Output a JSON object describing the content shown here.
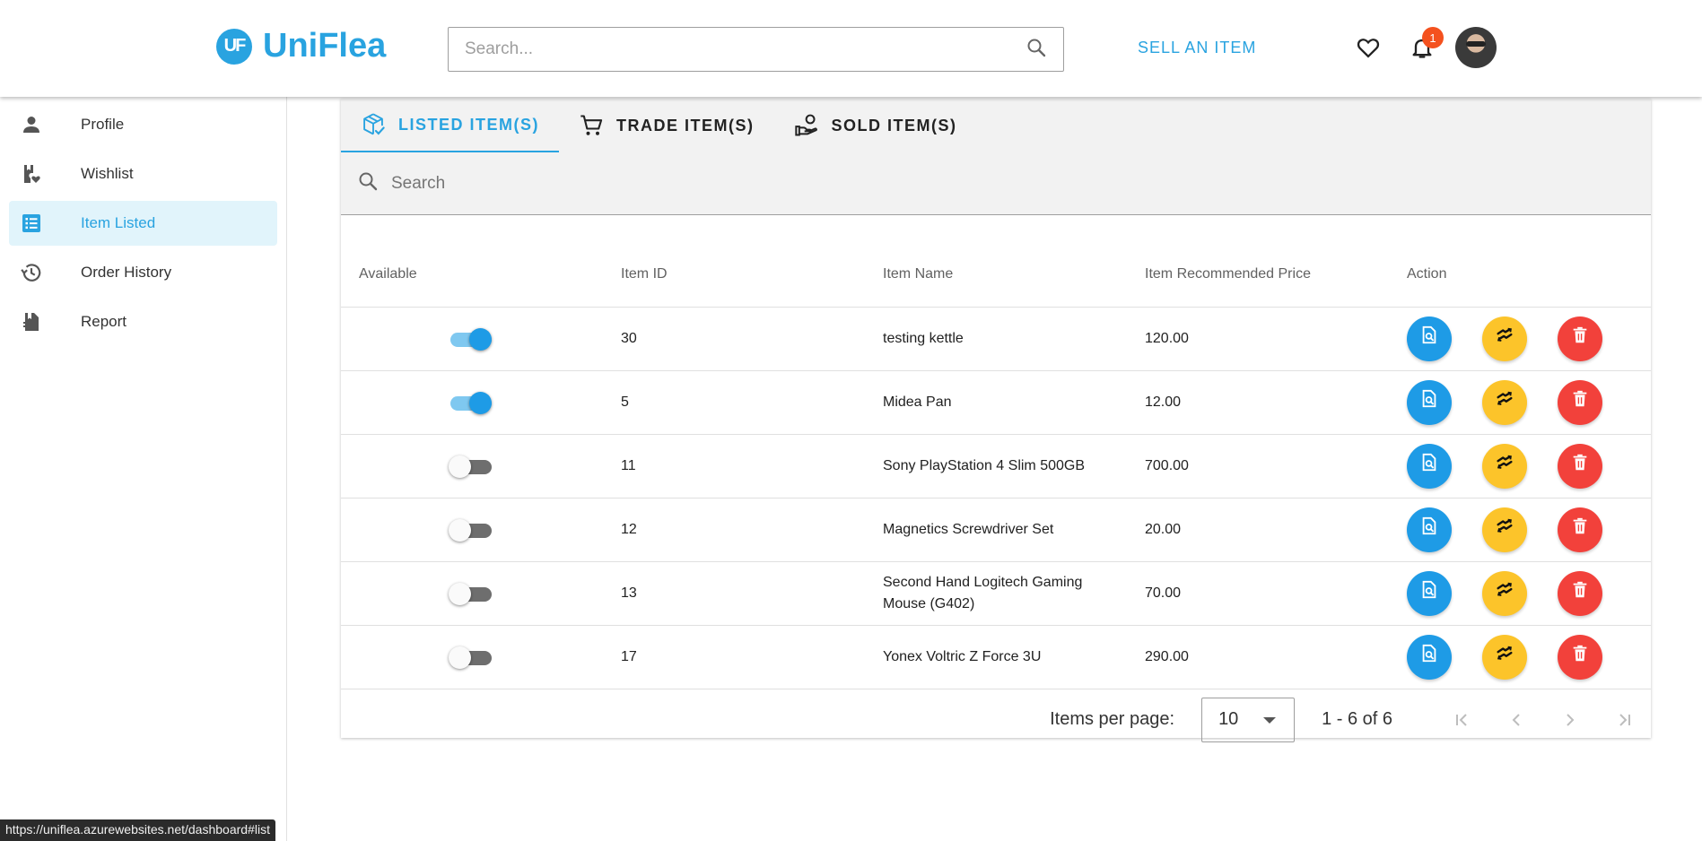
{
  "header": {
    "logo_mark": "UF",
    "logo_text": "UniFlea",
    "search_placeholder": "Search...",
    "sell_label": "SELL AN ITEM",
    "notification_count": "1"
  },
  "sidebar": {
    "items": [
      {
        "label": "Profile",
        "icon": "person-icon"
      },
      {
        "label": "Wishlist",
        "icon": "wishlist-icon"
      },
      {
        "label": "Item Listed",
        "icon": "list-icon",
        "active": true
      },
      {
        "label": "Order History",
        "icon": "history-icon"
      },
      {
        "label": "Report",
        "icon": "report-icon"
      }
    ]
  },
  "tabs": [
    {
      "label": "LISTED ITEM(S)",
      "active": true
    },
    {
      "label": "TRADE ITEM(S)"
    },
    {
      "label": "SOLD ITEM(S)"
    }
  ],
  "table": {
    "search_placeholder": "Search",
    "headers": [
      "Available",
      "Item ID",
      "Item Name",
      "Item Recommended Price",
      "Action"
    ],
    "rows": [
      {
        "available": true,
        "id": "30",
        "name": "testing kettle",
        "price": "120.00"
      },
      {
        "available": true,
        "id": "5",
        "name": "Midea Pan",
        "price": "12.00"
      },
      {
        "available": false,
        "id": "11",
        "name": "Sony PlayStation 4 Slim 500GB",
        "price": "700.00"
      },
      {
        "available": false,
        "id": "12",
        "name": "Magnetics Screwdriver Set",
        "price": "20.00"
      },
      {
        "available": false,
        "id": "13",
        "name": "Second Hand Logitech Gaming Mouse (G402)",
        "price": "70.00"
      },
      {
        "available": false,
        "id": "17",
        "name": "Yonex Voltric Z Force 3U",
        "price": "290.00"
      }
    ]
  },
  "pager": {
    "per_page_label": "Items per page:",
    "per_page_value": "10",
    "range": "1 - 6 of 6"
  },
  "status_url": "https://uniflea.azurewebsites.net/dashboard#list",
  "colors": {
    "accent": "#29a3e0",
    "view": "#1e9be6",
    "trade": "#fcc42a",
    "delete": "#f2413b"
  }
}
